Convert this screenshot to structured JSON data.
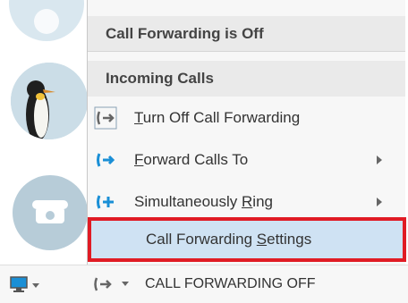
{
  "menu": {
    "status_header": "Call Forwarding is Off",
    "section_header": "Incoming Calls",
    "items": [
      {
        "label_pre": "",
        "label_ul": "T",
        "label_post": "urn Off Call Forwarding",
        "icon": "forwarding-off-icon",
        "has_submenu": false
      },
      {
        "label_pre": "",
        "label_ul": "F",
        "label_post": "orward Calls To",
        "icon": "forward-calls-icon",
        "has_submenu": true
      },
      {
        "label_pre": "Simultaneously ",
        "label_ul": "R",
        "label_post": "ing",
        "icon": "simultaneous-ring-icon",
        "has_submenu": true
      }
    ],
    "selected_item": {
      "label_pre": "Call Forwarding ",
      "label_ul": "S",
      "label_post": "ettings"
    }
  },
  "status_bar": {
    "text": "CALL FORWARDING OFF"
  },
  "colors": {
    "accent_blue": "#1a8fd6",
    "highlight_border": "#e01b24",
    "selected_bg": "#cfe2f3"
  }
}
